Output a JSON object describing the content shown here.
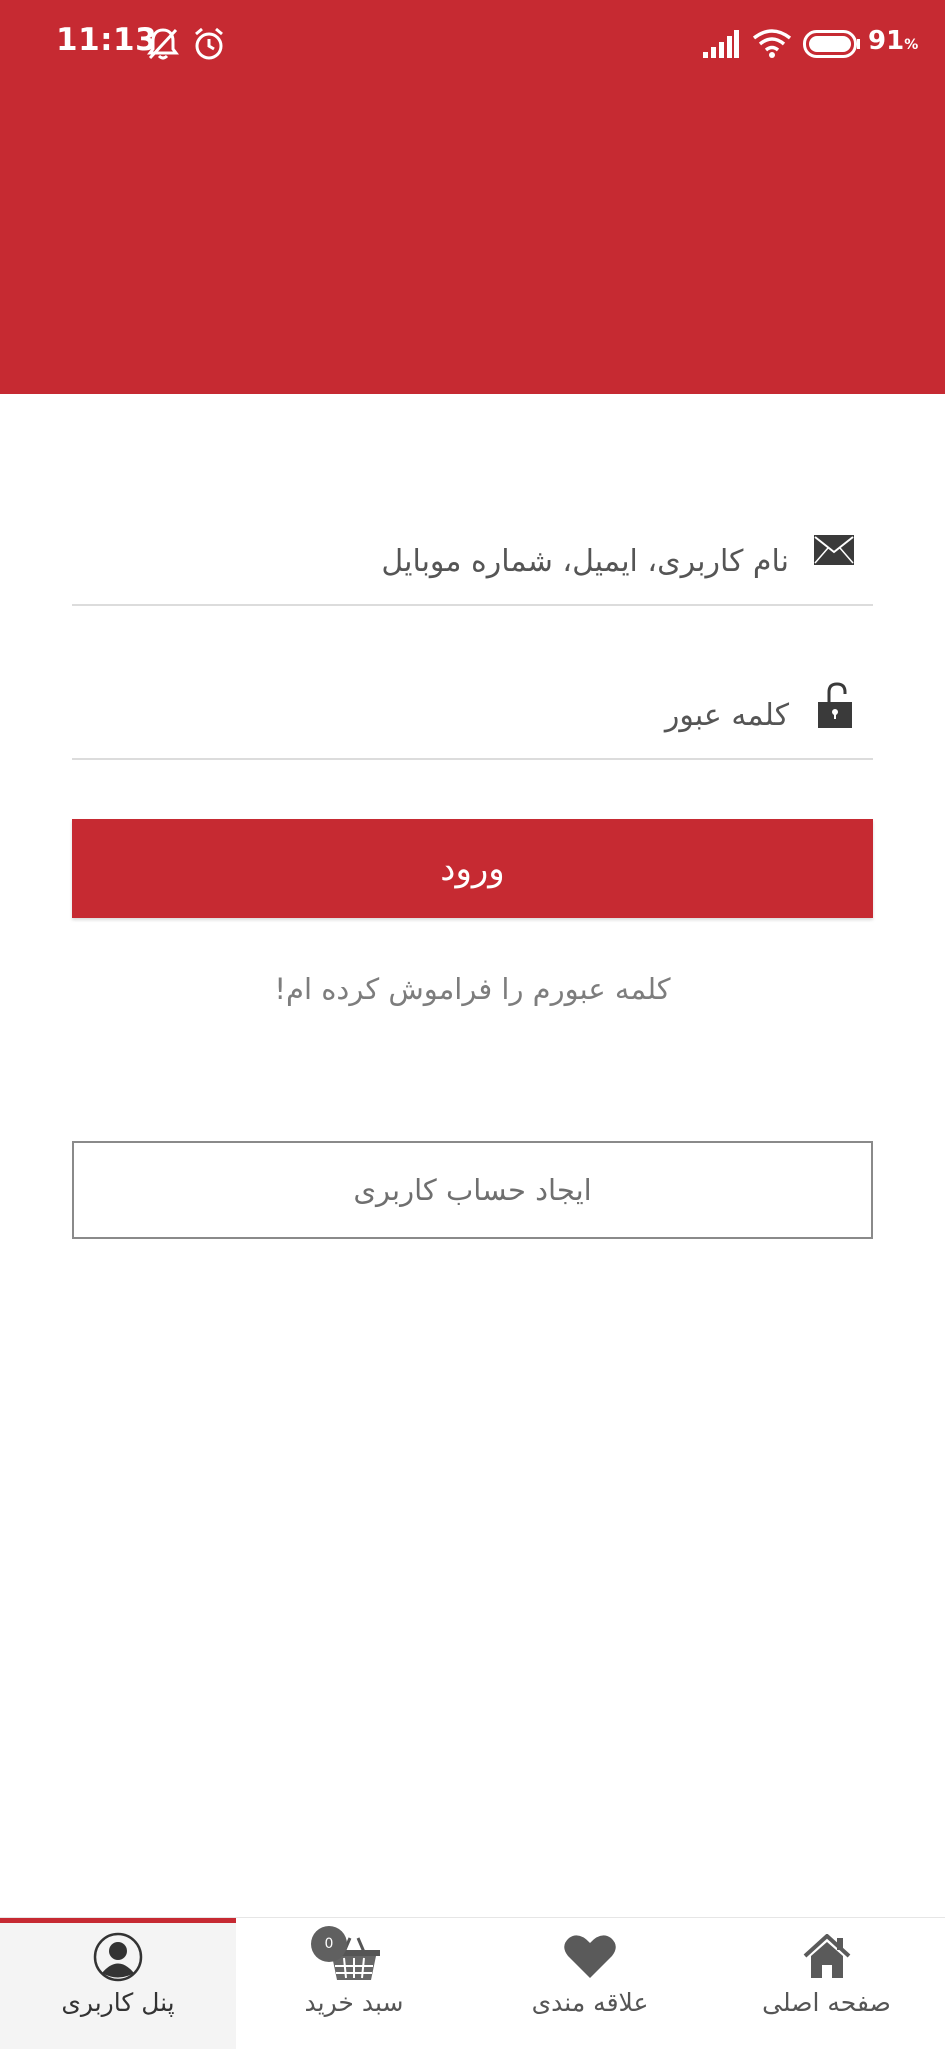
{
  "status_bar": {
    "time": "11:13",
    "battery_percent": "91",
    "battery_unit": "%"
  },
  "login_form": {
    "username_placeholder": "نام کاربری، ایمیل، شماره موبایل",
    "password_placeholder": "کلمه عبور",
    "login_label": "ورود",
    "forgot_password": "کلمه عبورم را فراموش کرده ام!",
    "register_label": "ایجاد حساب کاربری"
  },
  "bottom_nav": {
    "active_index": 0,
    "items": [
      {
        "label": "پنل کاربری",
        "icon": "user-icon"
      },
      {
        "label": "سبد خرید",
        "icon": "basket-icon",
        "badge": "0"
      },
      {
        "label": "علاقه مندی",
        "icon": "heart-icon"
      },
      {
        "label": "صفحه اصلی",
        "icon": "home-icon"
      }
    ]
  },
  "colors": {
    "brand": "#c62a32",
    "text_muted": "#7d7d7d"
  }
}
